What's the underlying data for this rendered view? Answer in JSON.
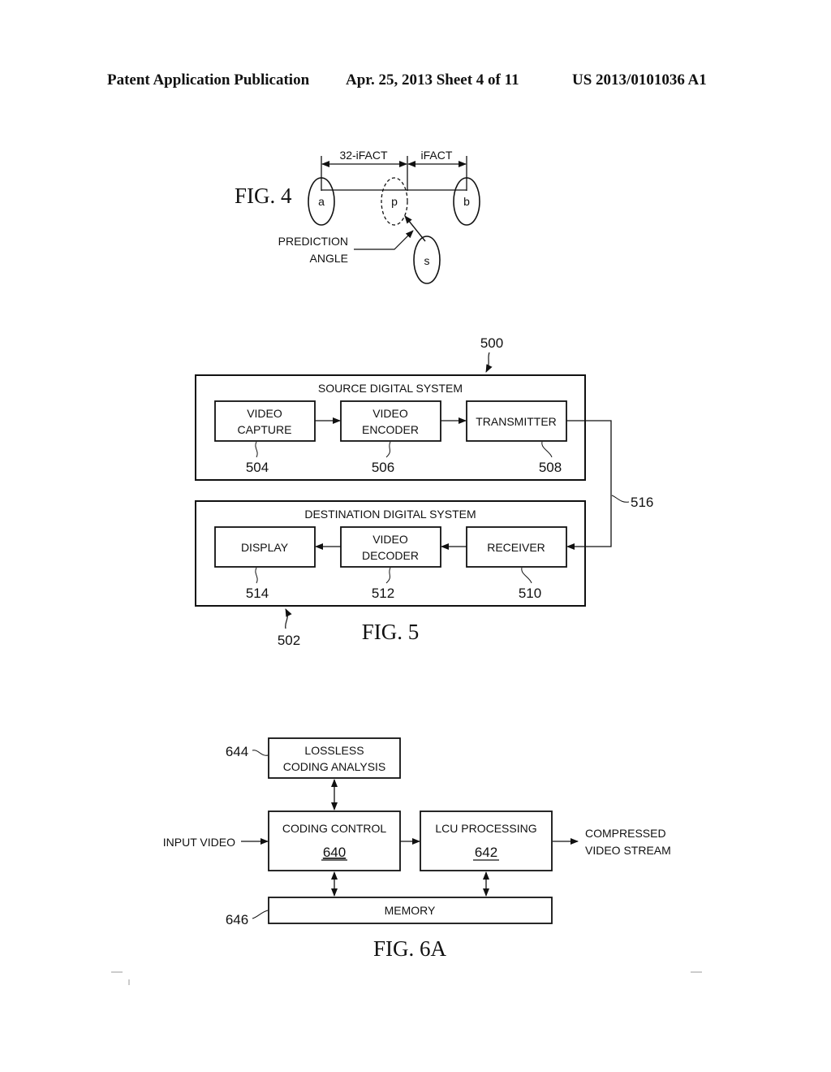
{
  "header": {
    "publication": "Patent Application Publication",
    "date_sheet": "Apr. 25, 2013  Sheet 4 of 11",
    "number": "US 2013/0101036 A1"
  },
  "fig4": {
    "title": "FIG. 4",
    "dim_left": "32-iFACT",
    "dim_right": "iFACT",
    "node_a": "a",
    "node_p": "p",
    "node_b": "b",
    "node_s": "s",
    "angle_label_1": "PREDICTION",
    "angle_label_2": "ANGLE"
  },
  "fig5": {
    "title": "FIG. 5",
    "ref_source": "500",
    "ref_dest": "502",
    "ref_link": "516",
    "source": {
      "title": "SOURCE DIGITAL SYSTEM",
      "blocks": [
        {
          "line1": "VIDEO",
          "line2": "CAPTURE",
          "ref": "504"
        },
        {
          "line1": "VIDEO",
          "line2": "ENCODER",
          "ref": "506"
        },
        {
          "line1": "TRANSMITTER",
          "line2": "",
          "ref": "508"
        }
      ]
    },
    "destination": {
      "title": "DESTINATION DIGITAL SYSTEM",
      "blocks": [
        {
          "line1": "DISPLAY",
          "line2": "",
          "ref": "514"
        },
        {
          "line1": "VIDEO",
          "line2": "DECODER",
          "ref": "512"
        },
        {
          "line1": "RECEIVER",
          "line2": "",
          "ref": "510"
        }
      ]
    }
  },
  "fig6a": {
    "title": "FIG. 6A",
    "lossless_1": "LOSSLESS",
    "lossless_2": "CODING ANALYSIS",
    "lossless_ref": "644",
    "coding_control": "CODING CONTROL",
    "coding_control_ref": "640",
    "lcu_processing": "LCU PROCESSING",
    "lcu_processing_ref": "642",
    "memory": "MEMORY",
    "memory_ref": "646",
    "input": "INPUT VIDEO",
    "output_1": "COMPRESSED",
    "output_2": "VIDEO STREAM"
  }
}
